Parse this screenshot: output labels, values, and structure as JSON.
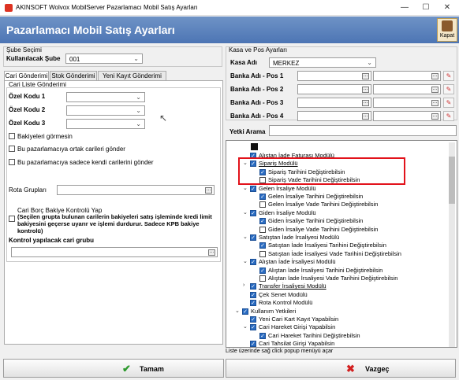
{
  "window": {
    "title": "AKINSOFT Wolvox MobilServer Pazarlamacı Mobil Satış Ayarları",
    "minimize": "—",
    "maximize": "☐",
    "close": "✕"
  },
  "header": {
    "title": "Pazarlamacı Mobil Satış Ayarları",
    "close_label": "Kapat",
    "close_icon": "door-exit-icon"
  },
  "left": {
    "sube_group": "Şube Seçimi",
    "sube_label": "Kullanılacak Şube",
    "sube_value": "001",
    "tabs": [
      "Cari Gönderimi",
      "Stok Gönderimi",
      "Yeni Kayıt Gönderimi"
    ],
    "cari_list_group": "Cari Liste Gönderimi",
    "ozel_kodu_1": "Özel Kodu 1",
    "ozel_kodu_2": "Özel Kodu 2",
    "ozel_kodu_3": "Özel Kodu 3",
    "chk_bakiye": "Bakiyeleri görmesin",
    "chk_ortak": "Bu pazarlamacıya ortak carileri gönder",
    "chk_kendi": "Bu pazarlamacıya sadece kendi carilerini gönder",
    "rota_label": "Rota Grupları",
    "borc_title": "Cari Borç Bakiye Kontrolü Yap",
    "borc_desc": "(Seçilen grupta bulunan carilerin bakiyeleri satış işleminde kredi limit bakiyesini geçerse uyarır ve işlemi durdurur. Sadece KPB bakiye kontrolü)",
    "kontrol_group": "Kontrol yapılacak cari grubu"
  },
  "right": {
    "kasa_group": "Kasa ve Pos Ayarları",
    "kasa_label": "Kasa Adı",
    "kasa_value": "MERKEZ",
    "pos1": "Banka Adı - Pos 1",
    "pos2": "Banka Adı - Pos 2",
    "pos3": "Banka Adı - Pos 3",
    "pos4": "Banka Adı - Pos 4",
    "yetki_label": "Yetki Arama",
    "tree": [
      {
        "text": "Alıştan İade Faturası Modülü",
        "level": 1,
        "state": "checked"
      },
      {
        "text": "Sipariş Modülü",
        "level": 1,
        "state": "checked",
        "u": true
      },
      {
        "text": "Sipariş Tarihini Değiştirebilsin",
        "level": 2,
        "state": "checked"
      },
      {
        "text": "Sipariş Vade Tarihini Değiştirebilsin",
        "level": 2,
        "state": "unchecked"
      },
      {
        "text": "Gelen İrsaliye Modülü",
        "level": 1,
        "state": "checked"
      },
      {
        "text": "Gelen İrsaliye Tarihini Değiştirebilsin",
        "level": 2,
        "state": "checked"
      },
      {
        "text": "Gelen İrsaliye Vade Tarihini Değiştirebilsin",
        "level": 2,
        "state": "unchecked"
      },
      {
        "text": "Giden İrsaliye Modülü",
        "level": 1,
        "state": "checked"
      },
      {
        "text": "Giden İrsaliye Tarihini Değiştirebilsin",
        "level": 2,
        "state": "checked"
      },
      {
        "text": "Giden İrsaliye Vade Tarihini Değiştirebilsin",
        "level": 2,
        "state": "unchecked"
      },
      {
        "text": "Satıştan İade İrsaliyesi Modülü",
        "level": 1,
        "state": "checked"
      },
      {
        "text": "Satıştan İade İrsaliyesi Tarihini Değiştirebilsin",
        "level": 2,
        "state": "checked"
      },
      {
        "text": "Satıştan İade İrsaliyesi Vade Tarihini Değiştirebilsin",
        "level": 2,
        "state": "unchecked"
      },
      {
        "text": "Alıştan İade İrsaliyesi Modülü",
        "level": 1,
        "state": "checked"
      },
      {
        "text": "Alıştan İade İrsaliyesi Tarihini Değiştirebilsin",
        "level": 2,
        "state": "checked"
      },
      {
        "text": "Alıştan İade İrsaliyesi Vade Tarihini Değiştirebilsin",
        "level": 2,
        "state": "unchecked"
      },
      {
        "text": "Transfer İrsaliyesi Modülü",
        "level": 1,
        "state": "checked",
        "u": true
      },
      {
        "text": "Çek Senet Modülü",
        "level": 1,
        "state": "checked"
      },
      {
        "text": "Rota Kontrol Modülü",
        "level": 1,
        "state": "checked"
      },
      {
        "text": "Kullanım Yetkileri",
        "level": 0,
        "state": "checked"
      },
      {
        "text": "Yeni Cari Kart Kayıt Yapabilsin",
        "level": 1,
        "state": "checked"
      },
      {
        "text": "Cari Hareket Girişi Yapabilsin",
        "level": 1,
        "state": "checked"
      },
      {
        "text": "Cari Hareket Tarihini Değiştirebilsin",
        "level": 2,
        "state": "checked"
      },
      {
        "text": "Cari Tahsilat Girişi Yapabilsin",
        "level": 1,
        "state": "checked"
      }
    ],
    "status_text": "Liste üzerinde sağ click popup menüyü açar"
  },
  "buttons": {
    "ok_label": "Tamam",
    "cancel_label": "Vazgeç",
    "ok_color": "#2e9a2e",
    "cancel_color": "#d32020"
  }
}
